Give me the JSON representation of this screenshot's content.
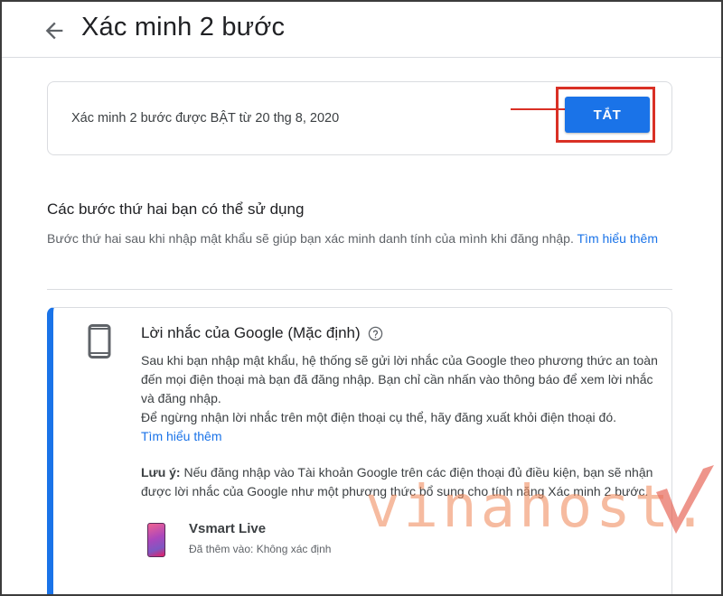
{
  "header": {
    "title": "Xác minh 2 bước"
  },
  "status": {
    "text": "Xác minh 2 bước được BẬT từ 20 thg 8, 2020",
    "button_label": "TẮT"
  },
  "second_steps": {
    "title": "Các bước thứ hai bạn có thể sử dụng",
    "description": "Bước thứ hai sau khi nhập mật khẩu sẽ giúp bạn xác minh danh tính của mình khi đăng nhập.",
    "learn_more": "Tìm hiểu thêm"
  },
  "google_prompt": {
    "title": "Lời nhắc của Google (Mặc định)",
    "body_1": "Sau khi bạn nhập mật khẩu, hệ thống sẽ gửi lời nhắc của Google theo phương thức an toàn đến mọi điện thoại mà bạn đã đăng nhập. Bạn chỉ cần nhấn vào thông báo để xem lời nhắc và đăng nhập.",
    "body_2": "Để ngừng nhận lời nhắc trên một điện thoại cụ thể, hãy đăng xuất khỏi điện thoại đó.",
    "learn_more": "Tìm hiểu thêm",
    "note_label": "Lưu ý:",
    "note_text": "Nếu đăng nhập vào Tài khoản Google trên các điện thoại đủ điều kiện, bạn sẽ nhận được lời nhắc của Google như một phương thức bổ sung cho tính năng Xác minh 2 bước.",
    "device": {
      "name": "Vsmart Live",
      "added": "Đã thêm vào: Không xác định"
    }
  },
  "watermark": {
    "text": "vinahost."
  },
  "colors": {
    "accent": "#1a73e8",
    "highlight": "#d93025",
    "watermark": "#ef8a5c"
  },
  "icons": {
    "back": "arrow-back-icon",
    "phone": "smartphone-icon",
    "help": "help-circle-icon"
  }
}
